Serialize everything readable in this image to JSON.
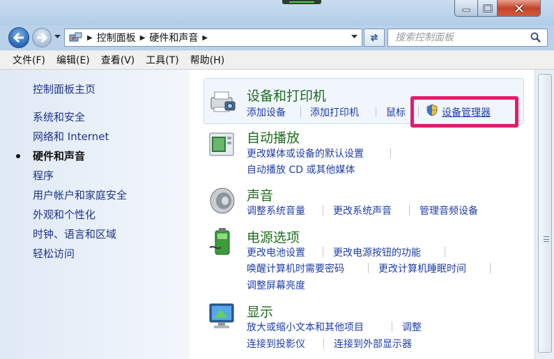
{
  "address": {
    "crumbs": [
      "控制面板",
      "硬件和声音"
    ],
    "search_placeholder": "搜索控制面板"
  },
  "menu": [
    "文件(F)",
    "编辑(E)",
    "查看(V)",
    "工具(T)",
    "帮助(H)"
  ],
  "sidebar": {
    "home": "控制面板主页",
    "items": [
      "系统和安全",
      "网络和 Internet",
      "硬件和声音",
      "程序",
      "用户帐户和家庭安全",
      "外观和个性化",
      "时钟、语言和区域",
      "轻松访问"
    ],
    "active_index": 2
  },
  "categories": [
    {
      "title": "设备和打印机",
      "icon": "printer-icon",
      "links": [
        [
          "添加设备",
          "添加打印机",
          "鼠标",
          "设备管理器"
        ]
      ]
    },
    {
      "title": "自动播放",
      "icon": "autoplay-icon",
      "links": [
        [
          "更改媒体或设备的默认设置"
        ],
        [
          "自动播放 CD 或其他媒体"
        ]
      ]
    },
    {
      "title": "声音",
      "icon": "speaker-icon",
      "links": [
        [
          "调整系统音量",
          "更改系统声音",
          "管理音频设备"
        ]
      ]
    },
    {
      "title": "电源选项",
      "icon": "battery-icon",
      "links": [
        [
          "更改电池设置",
          "更改电源按钮的功能"
        ],
        [
          "唤醒计算机时需要密码",
          "更改计算机睡眠时间"
        ],
        [
          "调整屏幕亮度"
        ]
      ]
    },
    {
      "title": "显示",
      "icon": "monitor-icon",
      "links": [
        [
          "放大或缩小文本和其他项目",
          "调整"
        ],
        [
          "连接到投影仪",
          "连接到外部显示器"
        ]
      ]
    }
  ],
  "highlight_color": "#e8196a"
}
